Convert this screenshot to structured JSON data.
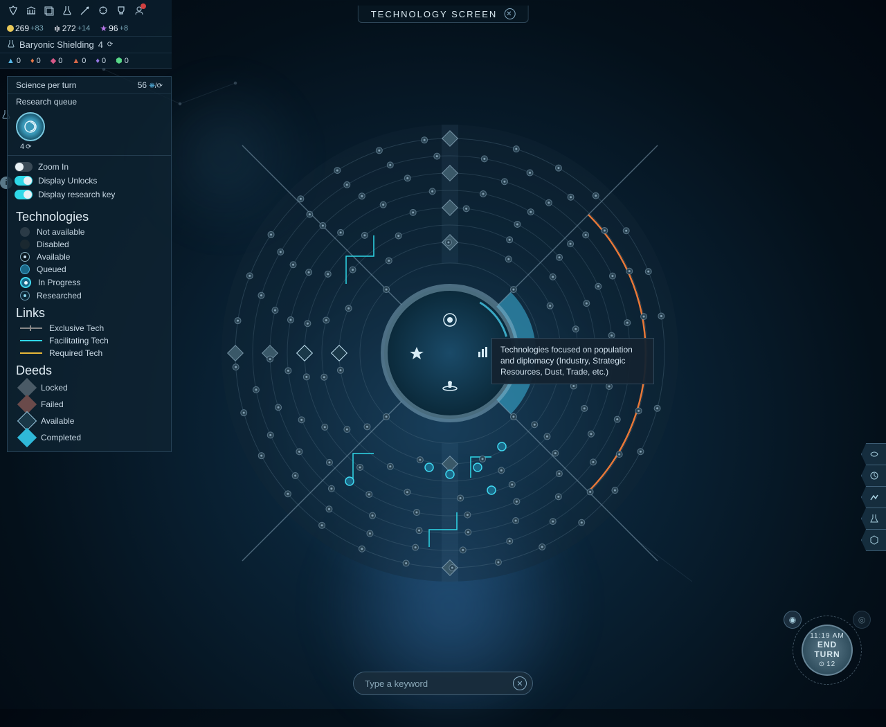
{
  "screen_title": "TECHNOLOGY SCREEN",
  "resources": {
    "dust": {
      "value": "269",
      "delta": "+83",
      "color": "#e8c858"
    },
    "influence": {
      "value": "272",
      "delta": "+14",
      "color": "#e8e8f0"
    },
    "prestige": {
      "value": "96",
      "delta": "+8",
      "color": "#b878e8"
    }
  },
  "current_research": {
    "name": "Baryonic Shielding",
    "turns": "4"
  },
  "fids": [
    {
      "color": "#58b8e8",
      "value": "0"
    },
    {
      "color": "#e87848",
      "value": "0"
    },
    {
      "color": "#d85888",
      "value": "0"
    },
    {
      "color": "#d86848",
      "value": "0"
    },
    {
      "color": "#9878e8",
      "value": "0"
    },
    {
      "color": "#58d888",
      "value": "0"
    }
  ],
  "science_per_turn": {
    "label": "Science per turn",
    "value": "56"
  },
  "research_queue_label": "Research queue",
  "queue_item_turns": "4",
  "toggles": {
    "zoom": {
      "label": "Zoom In",
      "on": false
    },
    "unlocks": {
      "label": "Display Unlocks",
      "on": true
    },
    "research_key": {
      "label": "Display research key",
      "on": true
    }
  },
  "sections": {
    "technologies": {
      "title": "Technologies",
      "items": [
        "Not available",
        "Disabled",
        "Available",
        "Queued",
        "In Progress",
        "Researched"
      ]
    },
    "links": {
      "title": "Links",
      "items": [
        "Exclusive Tech",
        "Facilitating Tech",
        "Required Tech"
      ]
    },
    "deeds": {
      "title": "Deeds",
      "items": [
        "Locked",
        "Failed",
        "Available",
        "Completed"
      ]
    }
  },
  "tooltip_text": "Technologies focused on population and diplomacy (Industry, Strategic Resources, Dust, Trade, etc.)",
  "search_placeholder": "Type a keyword",
  "end_turn": {
    "time": "11:19 AM",
    "label1": "END",
    "label2": "TURN",
    "turn_count": "12"
  }
}
